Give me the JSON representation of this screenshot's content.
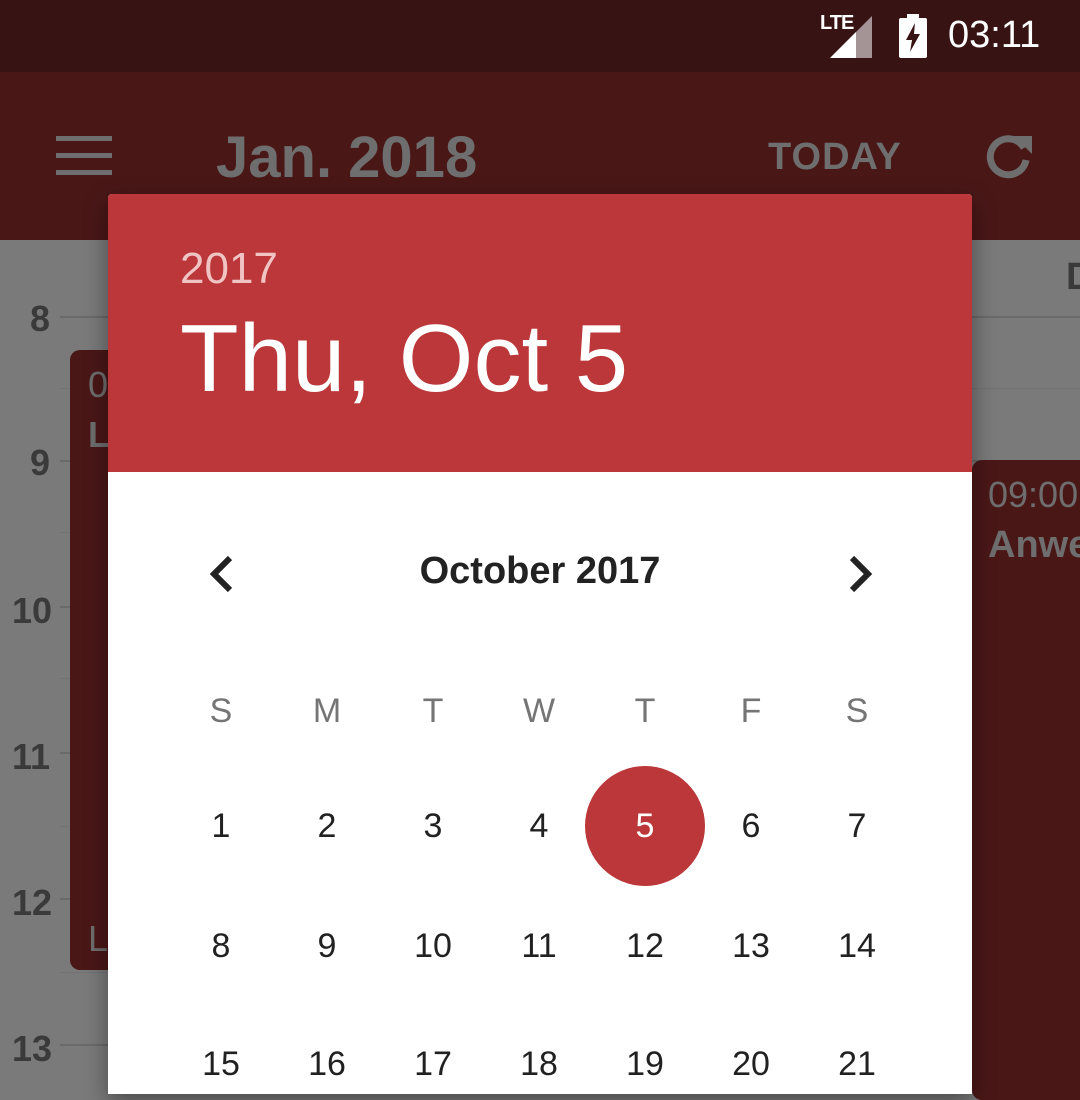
{
  "status_bar": {
    "network": "LTE",
    "time": "03:11"
  },
  "app_bar": {
    "title": "Jan. 2018",
    "today_label": "TODAY"
  },
  "calendar_bg": {
    "hours": [
      "8",
      "9",
      "10",
      "11",
      "12",
      "13"
    ],
    "day_header": "D",
    "events": {
      "left_time": "0",
      "left_title": "L",
      "left_foot": "L",
      "right_time": "09:00",
      "right_title": "Anwe"
    }
  },
  "dialog": {
    "year": "2017",
    "selected_date": "Thu, Oct 5",
    "month_title": "October 2017",
    "weekdays": [
      "S",
      "M",
      "T",
      "W",
      "T",
      "F",
      "S"
    ],
    "days": [
      "1",
      "2",
      "3",
      "4",
      "5",
      "6",
      "7",
      "8",
      "9",
      "10",
      "11",
      "12",
      "13",
      "14",
      "15",
      "16",
      "17",
      "18",
      "19",
      "20",
      "21"
    ],
    "selected_day": "5"
  },
  "colors": {
    "status_bar": "#381314",
    "app_bar_dimmed": "#4a1717",
    "dialog_header": "#bb3739",
    "selected_circle": "#bb3739"
  }
}
